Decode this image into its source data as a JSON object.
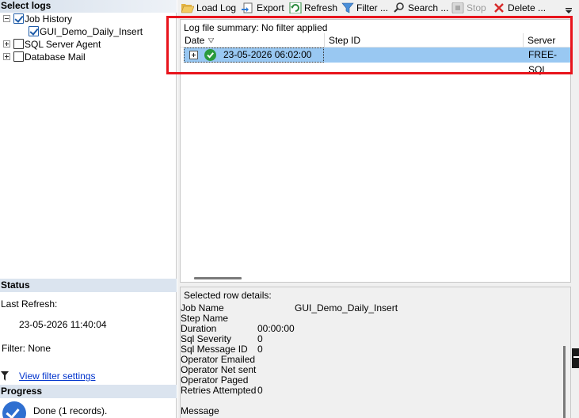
{
  "left": {
    "select_logs_header": "Select logs",
    "tree": [
      {
        "label": "Job History",
        "checked": true,
        "expanded": true
      },
      {
        "label": "GUI_Demo_Daily_Insert",
        "checked": true
      },
      {
        "label": "SQL Server Agent",
        "checked": false,
        "expanded": false
      },
      {
        "label": "Database Mail",
        "checked": false,
        "expanded": false
      }
    ],
    "status_header": "Status",
    "last_refresh_label": "Last Refresh:",
    "last_refresh_value": "23-05-2026 11:40:04",
    "filter_text": "Filter: None",
    "view_filter_link": "View filter settings",
    "progress_header": "Progress",
    "progress_text": "Done (1 records)."
  },
  "toolbar": {
    "load_log": "Load Log",
    "export": "Export",
    "refresh": "Refresh",
    "filter": "Filter ...",
    "search": "Search ...",
    "stop": "Stop",
    "delete": "Delete ..."
  },
  "grid": {
    "summary": "Log file summary: No filter applied",
    "columns": [
      "Date",
      "Step ID",
      "Server"
    ],
    "rows": [
      {
        "date": "23-05-2026 06:02:00",
        "step_id": "",
        "server": "FREE-SQL",
        "status": "success"
      }
    ]
  },
  "details": {
    "header": "Selected row details:",
    "fields": [
      {
        "label": "Job Name",
        "value": "GUI_Demo_Daily_Insert"
      },
      {
        "label": "Step Name",
        "value": ""
      },
      {
        "label": "Duration",
        "value": "00:00:00"
      },
      {
        "label": "Sql Severity",
        "value": "0"
      },
      {
        "label": "Sql Message ID",
        "value": "0"
      },
      {
        "label": "Operator Emailed",
        "value": ""
      },
      {
        "label": "Operator Net sent",
        "value": ""
      },
      {
        "label": "Operator Paged",
        "value": ""
      },
      {
        "label": "Retries Attempted",
        "value": "0"
      }
    ],
    "message_label": "Message"
  },
  "colors": {
    "selected_row": "#99c8f2",
    "highlight_border": "#e8141c",
    "section_header": "#dbe4ef",
    "link": "#0033cc"
  }
}
